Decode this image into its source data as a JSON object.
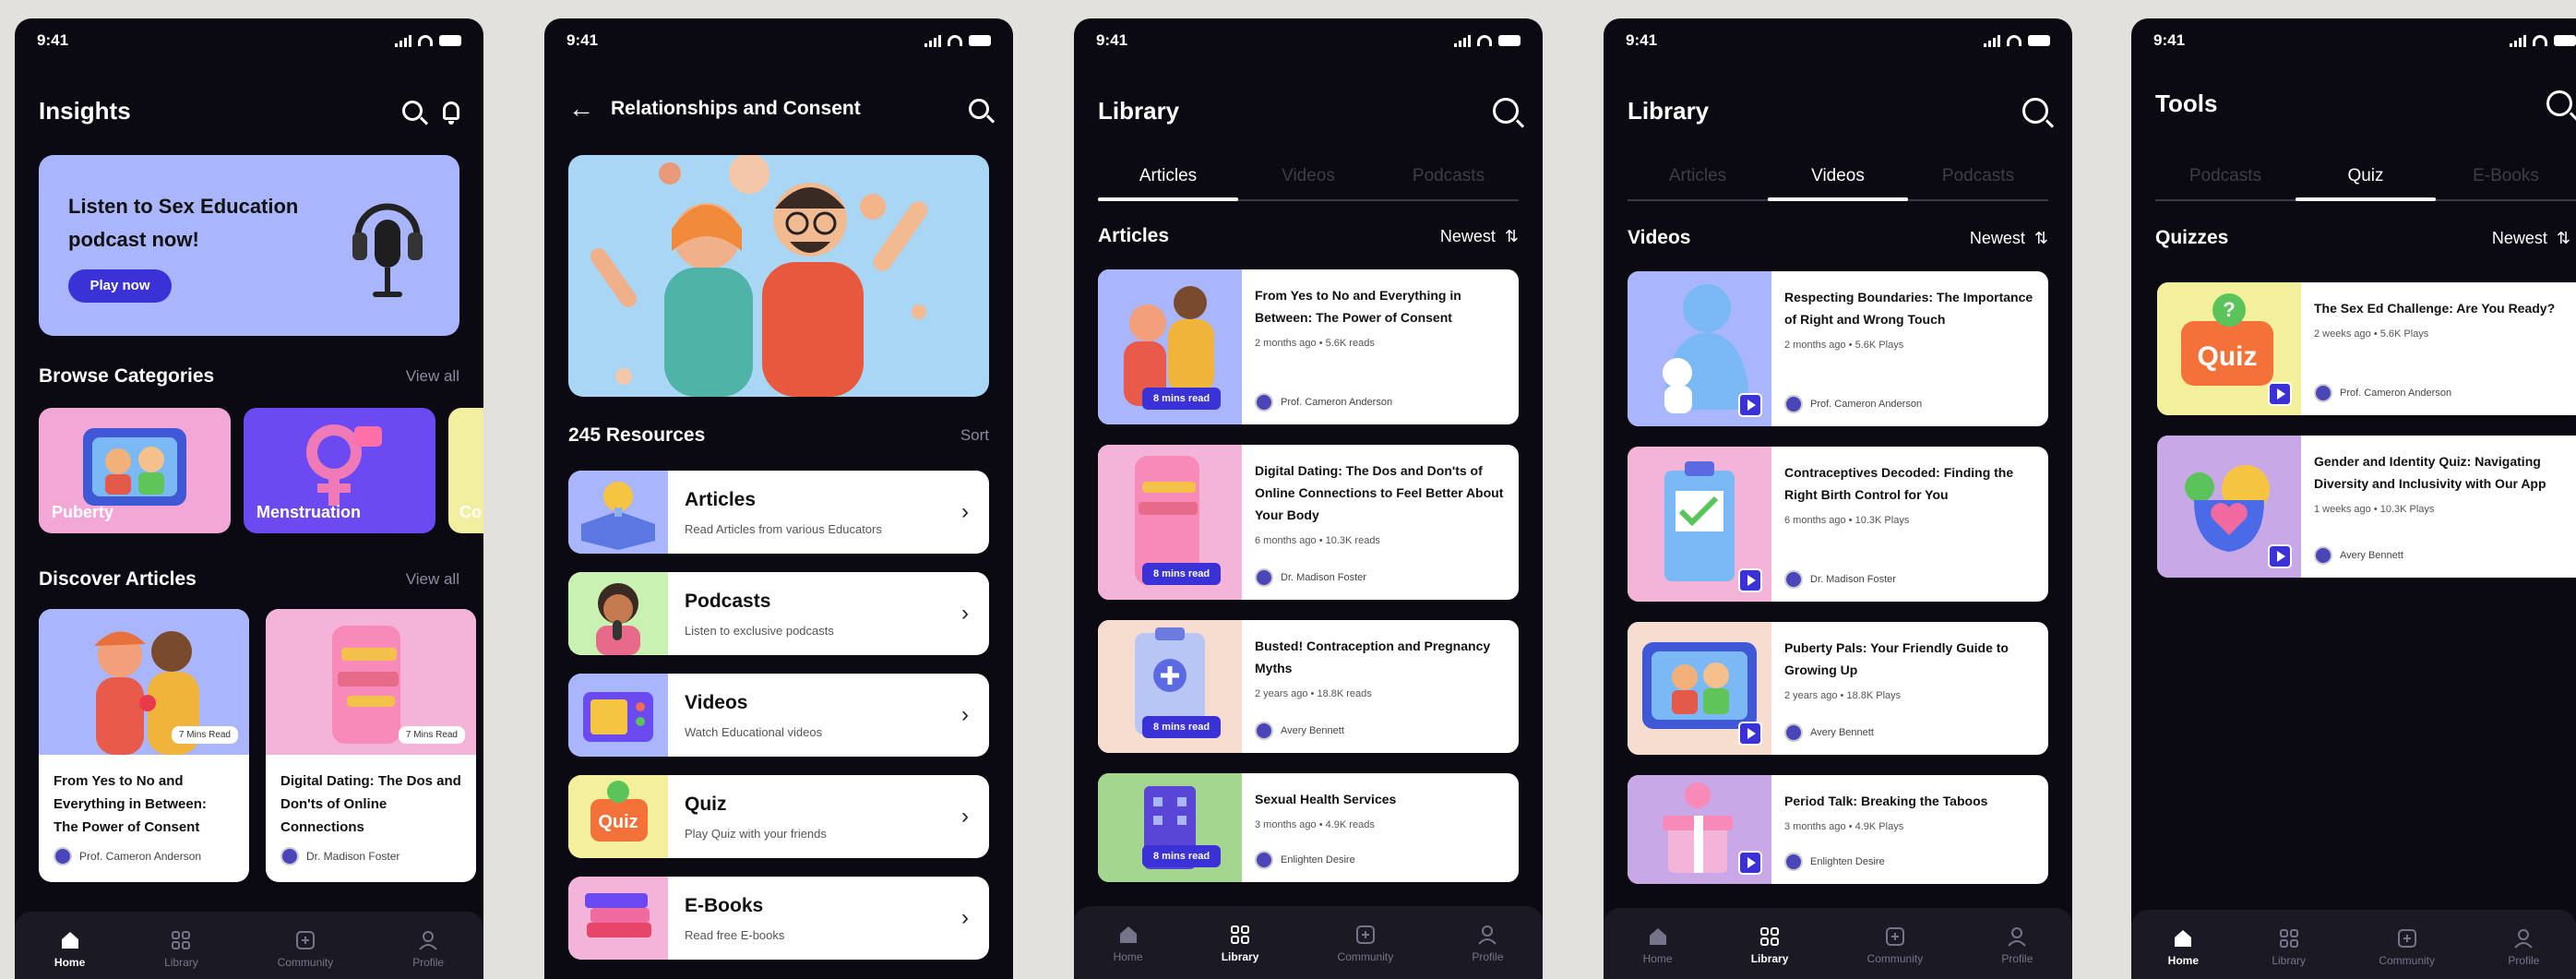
{
  "status_time": "9:41",
  "colors": {
    "bg": "#0b0a12",
    "accent": "#3a31d6",
    "banner": "#a9b6fb",
    "nav_bg": "#1b1a24"
  },
  "nav": {
    "home": "Home",
    "library": "Library",
    "community": "Community",
    "profile": "Profile"
  },
  "screen1": {
    "title": "Insights",
    "banner_text": "Listen to Sex Education podcast now!",
    "banner_button": "Play now",
    "browse_title": "Browse Categories",
    "view_all": "View all",
    "categories": [
      "Puberty",
      "Menstruation",
      "Co"
    ],
    "discover_title": "Discover Articles",
    "articles": [
      {
        "title": "From Yes to No and Everything in Between: The Power of Consent",
        "author": "Prof. Cameron Anderson",
        "tag": "7 Mins Read"
      },
      {
        "title": "Digital Dating: The Dos and Don'ts of Online Connections",
        "author": "Dr. Madison Foster",
        "tag": "7 Mins Read"
      }
    ]
  },
  "screen2": {
    "title": "Relationships and Consent",
    "resources_count": "245 Resources",
    "sort": "Sort",
    "items": [
      {
        "title": "Articles",
        "sub": "Read Articles from various Educators"
      },
      {
        "title": "Podcasts",
        "sub": "Listen to exclusive podcasts"
      },
      {
        "title": "Videos",
        "sub": "Watch Educational videos"
      },
      {
        "title": "Quiz",
        "sub": "Play Quiz with your friends"
      },
      {
        "title": "E-Books",
        "sub": "Read free E-books"
      }
    ]
  },
  "screen3": {
    "title": "Library",
    "tabs": [
      "Articles",
      "Videos",
      "Podcasts"
    ],
    "section": "Articles",
    "sort": "Newest",
    "items": [
      {
        "title": "From Yes to No and Everything in Between: The Power of Consent",
        "meta": "2 months ago  •  5.6K reads",
        "author": "Prof. Cameron Anderson",
        "tag": "8 mins read"
      },
      {
        "title": "Digital Dating: The Dos and Don'ts of Online Connections to Feel Better About Your Body",
        "meta": "6 months ago  •  10.3K reads",
        "author": "Dr. Madison Foster",
        "tag": "8 mins read"
      },
      {
        "title": "Busted! Contraception and Pregnancy Myths",
        "meta": "2 years ago  •  18.8K reads",
        "author": "Avery Bennett",
        "tag": "8 mins read"
      },
      {
        "title": "Sexual Health Services",
        "meta": "3 months ago  •  4.9K reads",
        "author": "Enlighten Desire",
        "tag": "8 mins read"
      }
    ]
  },
  "screen4": {
    "title": "Library",
    "tabs": [
      "Articles",
      "Videos",
      "Podcasts"
    ],
    "section": "Videos",
    "sort": "Newest",
    "items": [
      {
        "title": "Respecting Boundaries: The Importance of Right and Wrong Touch",
        "meta": "2 months ago  •  5.6K Plays",
        "author": "Prof. Cameron Anderson"
      },
      {
        "title": "Contraceptives Decoded: Finding the Right Birth Control for You",
        "meta": "6 months ago  •  10.3K Plays",
        "author": "Dr. Madison Foster"
      },
      {
        "title": "Puberty Pals: Your Friendly Guide to Growing Up",
        "meta": "2 years ago  •  18.8K Plays",
        "author": "Avery Bennett"
      },
      {
        "title": "Period Talk: Breaking the Taboos",
        "meta": "3 months ago  •  4.9K Plays",
        "author": "Enlighten Desire"
      }
    ]
  },
  "screen5": {
    "title": "Tools",
    "tabs": [
      "Podcasts",
      "Quiz",
      "E-Books"
    ],
    "section": "Quizzes",
    "sort": "Newest",
    "quiz_badge": "Quiz",
    "items": [
      {
        "title": "The Sex Ed Challenge: Are You Ready?",
        "meta": "2 weeks ago  •  5.6K Plays",
        "author": "Prof. Cameron Anderson"
      },
      {
        "title": "Gender and Identity Quiz: Navigating Diversity and Inclusivity with Our App",
        "meta": "1 weeks ago  •  10.3K Plays",
        "author": "Avery Bennett"
      }
    ]
  }
}
